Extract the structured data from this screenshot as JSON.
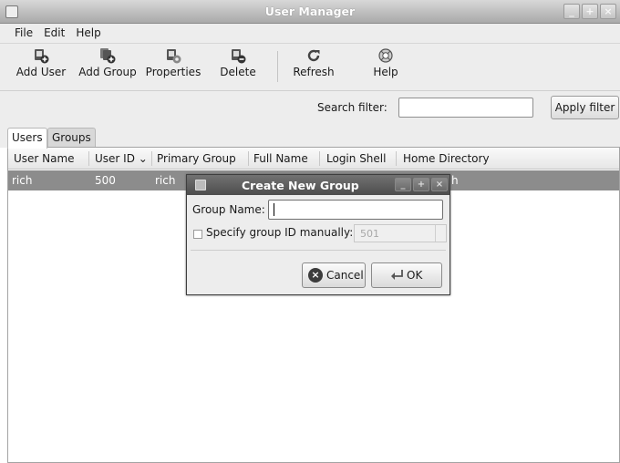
{
  "window": {
    "title": "User Manager",
    "controls": [
      "_",
      "+",
      "×"
    ]
  },
  "menu": {
    "file": "File",
    "edit": "Edit",
    "help": "Help"
  },
  "toolbar": {
    "add_user": "Add User",
    "add_group": "Add Group",
    "properties": "Properties",
    "delete": "Delete",
    "refresh": "Refresh",
    "help": "Help"
  },
  "search": {
    "label": "Search filter:",
    "value": "",
    "apply_label": "Apply filter"
  },
  "tabs": [
    {
      "label": "Users",
      "active": true
    },
    {
      "label": "Groups",
      "active": false
    }
  ],
  "table": {
    "columns": [
      "User Name",
      "User ID ⌄",
      "Primary Group",
      "Full Name",
      "Login Shell",
      "Home Directory"
    ],
    "rows": [
      {
        "user_name": "rich",
        "user_id": "500",
        "primary_group": "rich",
        "home_directory_tail": "h"
      }
    ]
  },
  "dialog": {
    "title": "Create New Group",
    "group_name_label": "Group Name:",
    "group_name_value": "",
    "specify_gid_label": "Specify group ID manually:",
    "specify_gid_checked": false,
    "gid_value": "501",
    "cancel_label": "Cancel",
    "ok_label": "OK"
  },
  "colors": {
    "selected_row": "#8c8c8c",
    "dialog_title": "#5a5a5a",
    "window_bg": "#ededed"
  }
}
